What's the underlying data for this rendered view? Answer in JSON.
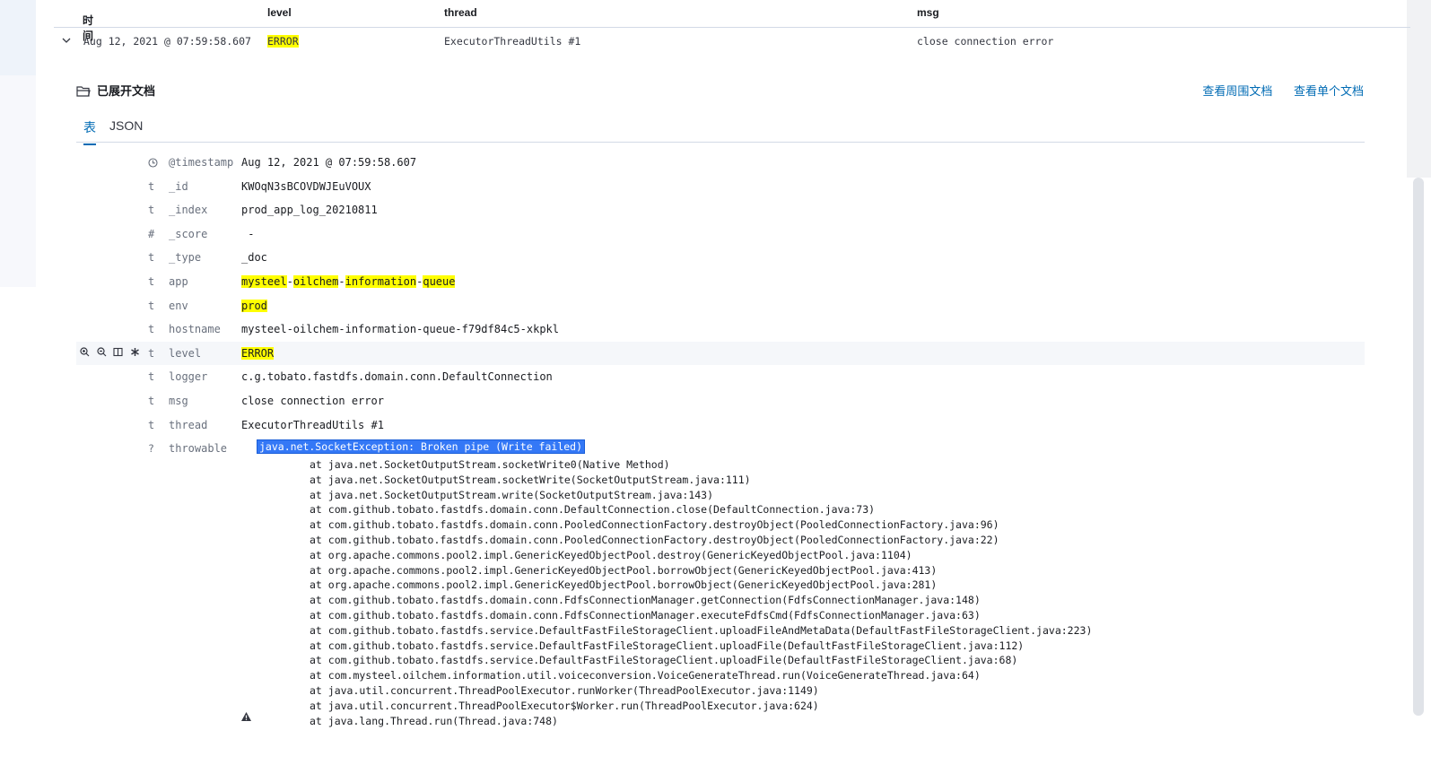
{
  "header": {
    "col_time": "时间",
    "col_level": "level",
    "col_thread": "thread",
    "col_msg": "msg"
  },
  "row": {
    "time": "Aug 12, 2021 @ 07:59:58.607",
    "level": "ERROR",
    "thread": "ExecutorThreadUtils #1",
    "msg": "close connection error"
  },
  "expanded": {
    "title": "已展开文档",
    "link_surrounding": "查看周围文档",
    "link_single": "查看单个文档"
  },
  "tabs": [
    "表",
    "JSON"
  ],
  "fields": [
    {
      "type": "clock-icon",
      "name": "@timestamp",
      "value": "Aug 12, 2021 @ 07:59:58.607"
    },
    {
      "type": "t",
      "name": "_id",
      "value": "KWOqN3sBCOVDWJEuVOUX"
    },
    {
      "type": "t",
      "name": "_index",
      "value": "prod_app_log_20210811"
    },
    {
      "type": "#",
      "name": "_score",
      "value": " -"
    },
    {
      "type": "t",
      "name": "_type",
      "value": "_doc"
    },
    {
      "type": "t",
      "name": "app",
      "value_parts": [
        "mysteel",
        "-",
        "oilchem",
        "-",
        "information",
        "-",
        "queue"
      ]
    },
    {
      "type": "t",
      "name": "env",
      "value": "prod"
    },
    {
      "type": "t",
      "name": "hostname",
      "value": "mysteel-oilchem-information-queue-f79df84c5-xkpkl"
    },
    {
      "type": "t",
      "name": "level",
      "value": "ERROR"
    },
    {
      "type": "t",
      "name": "logger",
      "value": "c.g.tobato.fastdfs.domain.conn.DefaultConnection"
    },
    {
      "type": "t",
      "name": "msg",
      "value": "close connection error"
    },
    {
      "type": "t",
      "name": "thread",
      "value": "ExecutorThreadUtils #1"
    }
  ],
  "throwable": {
    "type": "?",
    "name": "throwable",
    "headline": "java.net.SocketException: Broken pipe (Write failed)",
    "trace": "at java.net.SocketOutputStream.socketWrite0(Native Method)\nat java.net.SocketOutputStream.socketWrite(SocketOutputStream.java:111)\nat java.net.SocketOutputStream.write(SocketOutputStream.java:143)\nat com.github.tobato.fastdfs.domain.conn.DefaultConnection.close(DefaultConnection.java:73)\nat com.github.tobato.fastdfs.domain.conn.PooledConnectionFactory.destroyObject(PooledConnectionFactory.java:96)\nat com.github.tobato.fastdfs.domain.conn.PooledConnectionFactory.destroyObject(PooledConnectionFactory.java:22)\nat org.apache.commons.pool2.impl.GenericKeyedObjectPool.destroy(GenericKeyedObjectPool.java:1104)\nat org.apache.commons.pool2.impl.GenericKeyedObjectPool.borrowObject(GenericKeyedObjectPool.java:413)\nat org.apache.commons.pool2.impl.GenericKeyedObjectPool.borrowObject(GenericKeyedObjectPool.java:281)\nat com.github.tobato.fastdfs.domain.conn.FdfsConnectionManager.getConnection(FdfsConnectionManager.java:148)\nat com.github.tobato.fastdfs.domain.conn.FdfsConnectionManager.executeFdfsCmd(FdfsConnectionManager.java:63)\nat com.github.tobato.fastdfs.service.DefaultFastFileStorageClient.uploadFileAndMetaData(DefaultFastFileStorageClient.java:223)\nat com.github.tobato.fastdfs.service.DefaultFastFileStorageClient.uploadFile(DefaultFastFileStorageClient.java:112)\nat com.github.tobato.fastdfs.service.DefaultFastFileStorageClient.uploadFile(DefaultFastFileStorageClient.java:68)\nat com.mysteel.oilchem.information.util.voiceconversion.VoiceGenerateThread.run(VoiceGenerateThread.java:64)\nat java.util.concurrent.ThreadPoolExecutor.runWorker(ThreadPoolExecutor.java:1149)\nat java.util.concurrent.ThreadPoolExecutor$Worker.run(ThreadPoolExecutor.java:624)\nat java.lang.Thread.run(Thread.java:748)"
  },
  "colors": {
    "highlight": "#ffff00",
    "link": "#006bb4",
    "selection": "#3478f6"
  }
}
